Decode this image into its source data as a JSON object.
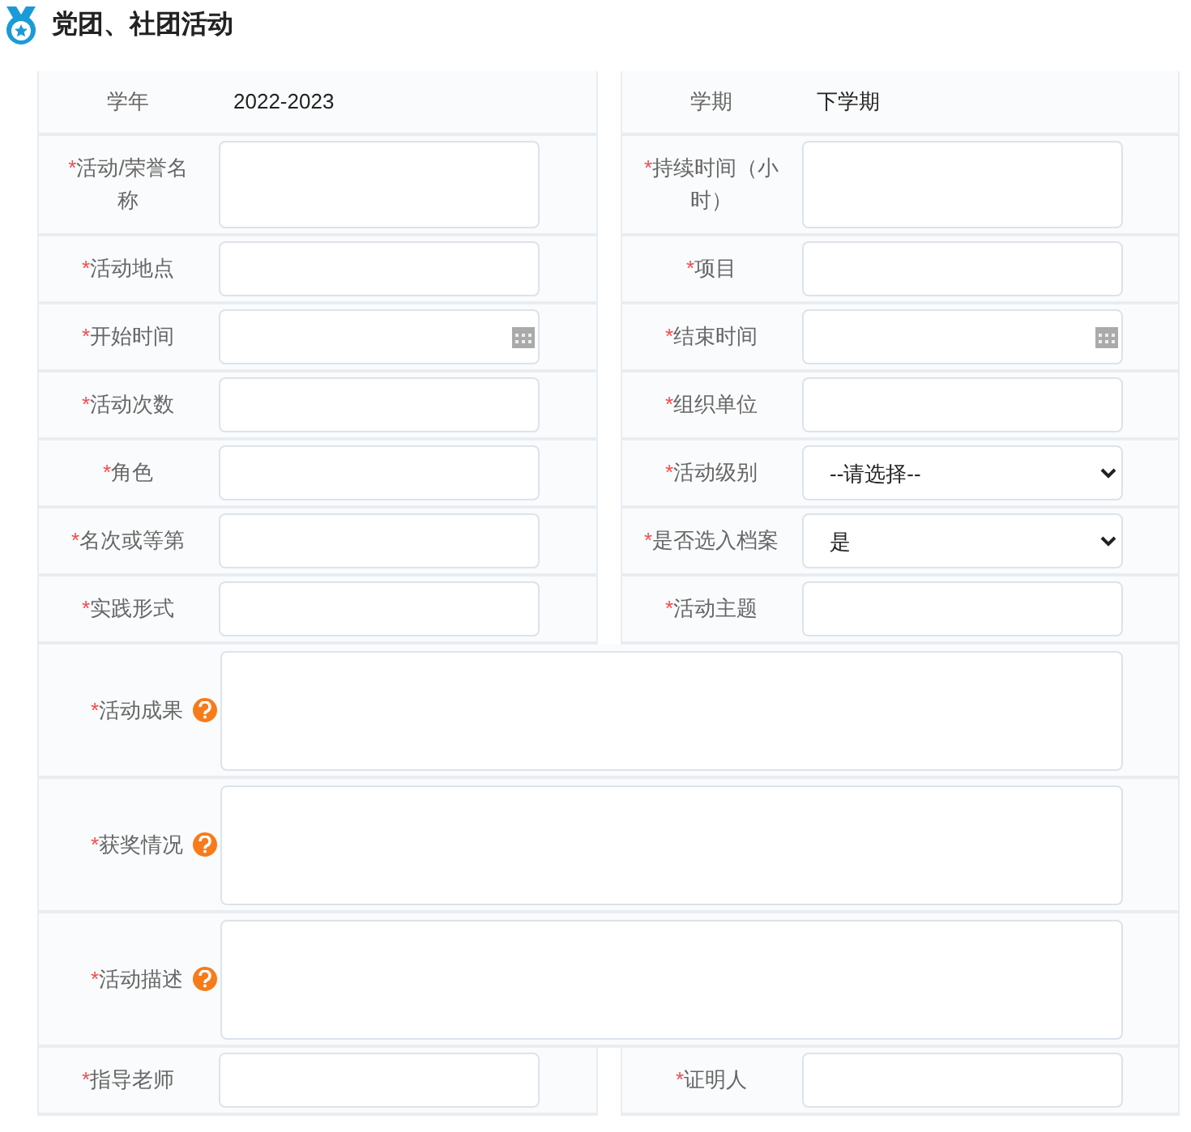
{
  "title": "党团、社团活动",
  "rows": [
    {
      "kind": "pair",
      "cells": [
        {
          "kind": "info",
          "label": "学年",
          "value": "2022-2023"
        },
        {
          "kind": "info",
          "label": "学期",
          "value": "下学期"
        }
      ]
    },
    {
      "kind": "pair",
      "cells": [
        {
          "kind": "tall",
          "label": "活动/荣誉名称",
          "required_mark": "*"
        },
        {
          "kind": "tall",
          "label": "持续时间（小时）",
          "required_mark": "*"
        }
      ]
    },
    {
      "kind": "pair",
      "cells": [
        {
          "kind": "text",
          "label": "活动地点",
          "required_mark": "*"
        },
        {
          "kind": "text",
          "label": "项目",
          "required_mark": "*"
        }
      ]
    },
    {
      "kind": "pair",
      "cells": [
        {
          "kind": "date",
          "label": "开始时间",
          "required_mark": "*"
        },
        {
          "kind": "date",
          "label": "结束时间",
          "required_mark": "*"
        }
      ]
    },
    {
      "kind": "pair",
      "cells": [
        {
          "kind": "text",
          "label": "活动次数",
          "required_mark": "*"
        },
        {
          "kind": "text",
          "label": "组织单位",
          "required_mark": "*"
        }
      ]
    },
    {
      "kind": "pair",
      "cells": [
        {
          "kind": "text",
          "label": "角色",
          "required_mark": "*"
        },
        {
          "kind": "select",
          "label": "活动级别",
          "required_mark": "*",
          "value": "--请选择--"
        }
      ]
    },
    {
      "kind": "pair",
      "cells": [
        {
          "kind": "text",
          "label": "名次或等第",
          "required_mark": "*"
        },
        {
          "kind": "select",
          "label": "是否选入档案",
          "required_mark": "*",
          "value": "是"
        }
      ]
    },
    {
      "kind": "pair",
      "cells": [
        {
          "kind": "text",
          "label": "实践形式",
          "required_mark": "*"
        },
        {
          "kind": "text",
          "label": "活动主题",
          "required_mark": "*"
        }
      ]
    },
    {
      "kind": "wide",
      "label": "活动成果",
      "required_mark": "*",
      "help": true
    },
    {
      "kind": "wide",
      "label": "获奖情况",
      "required_mark": "*",
      "help": true
    },
    {
      "kind": "wide",
      "label": "活动描述",
      "required_mark": "*",
      "help": true
    },
    {
      "kind": "pair",
      "cells": [
        {
          "kind": "text",
          "label": "指导老师",
          "required_mark": "*"
        },
        {
          "kind": "text",
          "label": "证明人",
          "required_mark": "*"
        }
      ]
    }
  ]
}
